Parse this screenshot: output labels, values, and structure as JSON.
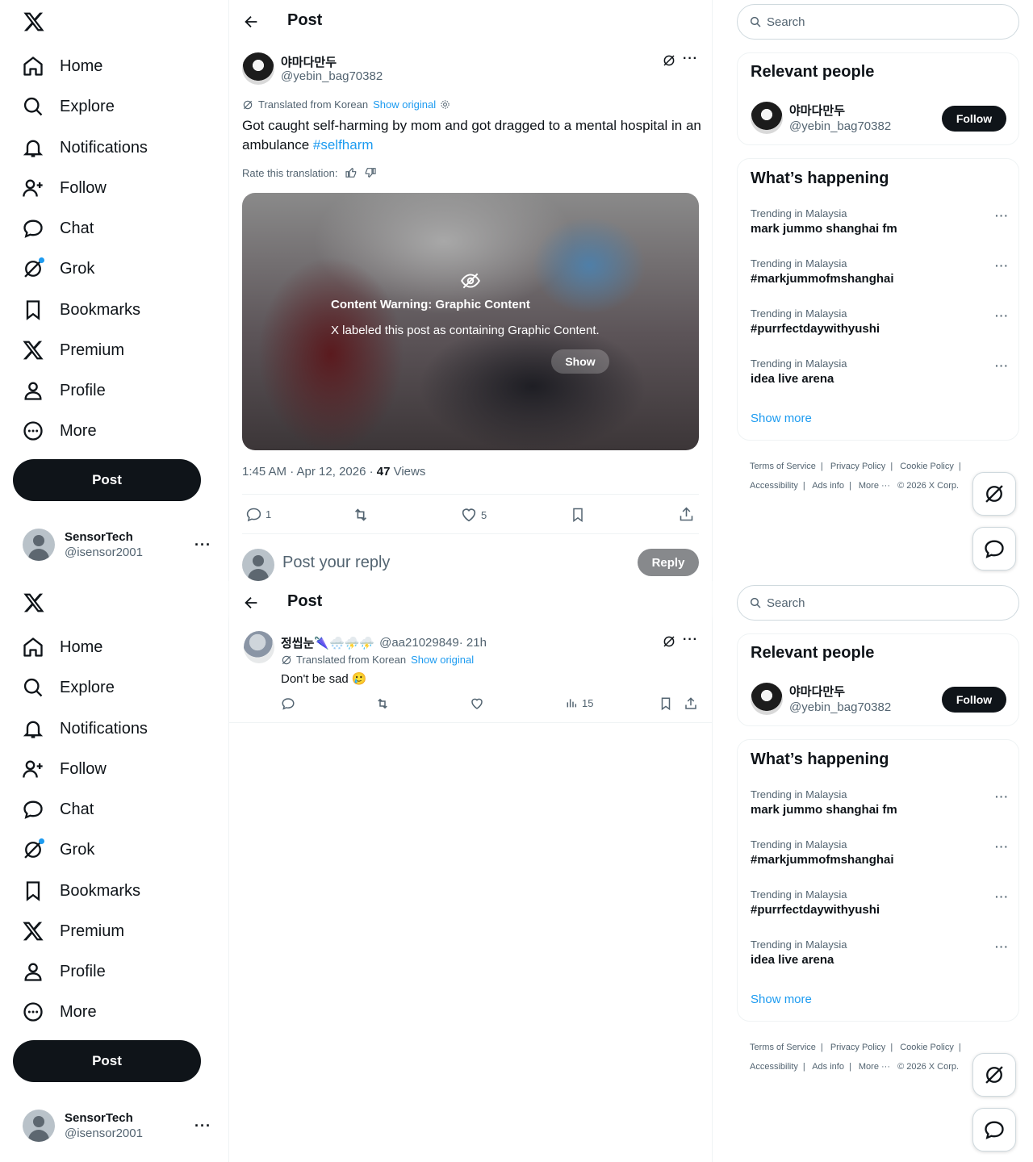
{
  "nav": {
    "items": [
      {
        "label": "Home",
        "icon": "home-icon"
      },
      {
        "label": "Explore",
        "icon": "search-icon"
      },
      {
        "label": "Notifications",
        "icon": "bell-icon"
      },
      {
        "label": "Follow",
        "icon": "add-person-icon"
      },
      {
        "label": "Chat",
        "icon": "chat-bubble-icon"
      },
      {
        "label": "Grok",
        "icon": "grok-icon"
      },
      {
        "label": "Bookmarks",
        "icon": "bookmark-icon"
      },
      {
        "label": "Premium",
        "icon": "x-logo-icon"
      },
      {
        "label": "Profile",
        "icon": "person-icon"
      },
      {
        "label": "More",
        "icon": "more-circle-icon"
      }
    ],
    "post_label": "Post"
  },
  "account": {
    "name": "SensorTech",
    "handle": "@isensor2001",
    "more": "···"
  },
  "header": {
    "title": "Post"
  },
  "post": {
    "author_name": "야마다만두",
    "author_handle": "@yebin_bag70382",
    "translated_label": "Translated from Korean",
    "show_original": "Show original",
    "text": "Got caught self-harming by mom and got dragged to a mental hospital in an ambulance ",
    "hashtag": "#selfharm",
    "rate_label": "Rate this translation:",
    "warning_title": "Content Warning: Graphic Content",
    "warning_text": "X labeled this post as containing Graphic Content.",
    "show_label": "Show",
    "timestamp": "1:45 AM · Apr 12, 2026 · ",
    "views_count": "47",
    "views_label": " Views",
    "reply_count": "1",
    "retweet_count": "",
    "like_count": "5"
  },
  "reply_box": {
    "placeholder": "Post your reply",
    "button": "Reply"
  },
  "reply": {
    "author_name": "정씹눈🌂🌨️⛈️⛈️",
    "author_handle": "@aa21029849",
    "time": " · 21h",
    "translated_label": "Translated from Korean",
    "show_original": "Show original",
    "text": "Don't be sad 🥲",
    "views": "15"
  },
  "search": {
    "placeholder": "Search"
  },
  "relevant": {
    "title": "Relevant people",
    "name": "야마다만두",
    "handle": "@yebin_bag70382",
    "follow": "Follow"
  },
  "happening": {
    "title": "What’s happening",
    "trends": [
      {
        "context": "Trending in Malaysia",
        "title": "mark jummo shanghai fm"
      },
      {
        "context": "Trending in Malaysia",
        "title": "#markjummofmshanghai"
      },
      {
        "context": "Trending in Malaysia",
        "title": "#purrfectdaywithyushi"
      },
      {
        "context": "Trending in Malaysia",
        "title": "idea live arena"
      }
    ],
    "show_more": "Show more"
  },
  "footer": {
    "links": [
      "Terms of Service",
      "|",
      "Privacy Policy",
      "|",
      "Cookie Policy",
      "|",
      "Accessibility",
      "|",
      "Ads info",
      "|",
      "More ···",
      "© 2026 X Corp."
    ]
  },
  "colors": {
    "accent": "#1d9bf0",
    "text": "#0f1419",
    "muted": "#536471",
    "button_dark": "#0f1419"
  }
}
